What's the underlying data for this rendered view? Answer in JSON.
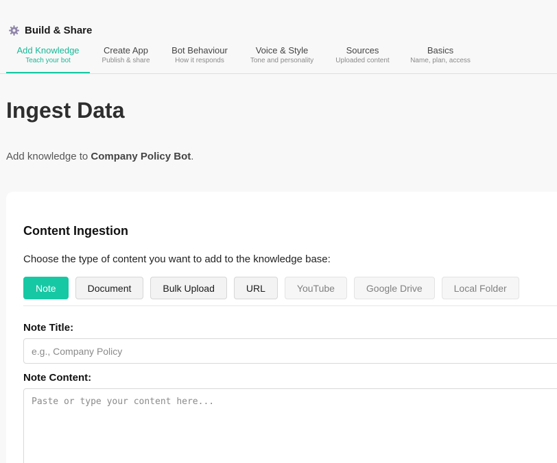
{
  "header": {
    "brand_title": "Build & Share",
    "brand_icon": "gear-icon",
    "tabs": [
      {
        "label": "Add Knowledge",
        "sub": "Teach your bot",
        "active": true
      },
      {
        "label": "Create App",
        "sub": "Publish & share"
      },
      {
        "label": "Bot Behaviour",
        "sub": "How it responds"
      },
      {
        "label": "Voice & Style",
        "sub": "Tone and personality"
      },
      {
        "label": "Sources",
        "sub": "Uploaded content"
      },
      {
        "label": "Basics",
        "sub": "Name, plan, access"
      }
    ]
  },
  "page": {
    "title": "Ingest Data",
    "intro_prefix": "Add knowledge to ",
    "bot_name": "Company Policy Bot",
    "intro_suffix": "."
  },
  "ingestion": {
    "title": "Content Ingestion",
    "description": "Choose the type of content you want to add to the knowledge base:",
    "types": [
      {
        "label": "Note",
        "state": "selected"
      },
      {
        "label": "Document",
        "state": "enabled"
      },
      {
        "label": "Bulk Upload",
        "state": "enabled"
      },
      {
        "label": "URL",
        "state": "enabled"
      },
      {
        "label": "YouTube",
        "state": "disabled"
      },
      {
        "label": "Google Drive",
        "state": "disabled"
      },
      {
        "label": "Local Folder",
        "state": "disabled"
      }
    ],
    "note_title_label": "Note Title:",
    "note_title_placeholder": "e.g., Company Policy",
    "note_content_label": "Note Content:",
    "note_content_placeholder": "Paste or type your content here..."
  },
  "colors": {
    "accent": "#17c8a4",
    "background": "#f8f8f8"
  }
}
